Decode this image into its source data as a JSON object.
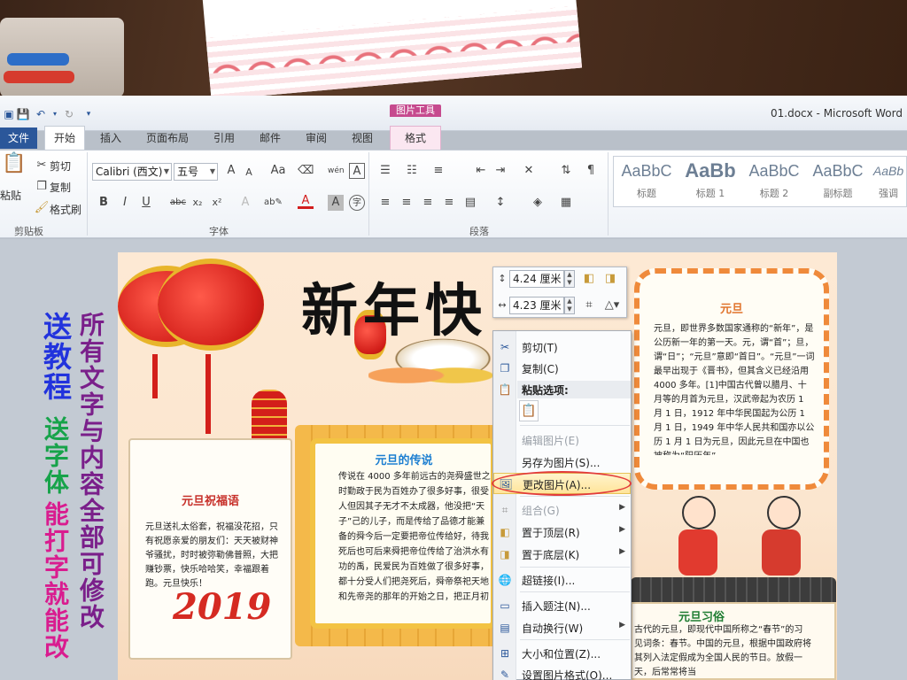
{
  "window": {
    "title": "01.docx - Microsoft Word",
    "picture_tools_label": "图片工具"
  },
  "tabs": {
    "file": "文件",
    "home": "开始",
    "insert": "插入",
    "page_layout": "页面布局",
    "references": "引用",
    "mailings": "邮件",
    "review": "审阅",
    "view": "视图",
    "format": "格式"
  },
  "clipboard": {
    "paste": "粘贴",
    "cut": "剪切",
    "copy": "复制",
    "format_painter": "格式刷",
    "group_label": "剪贴板"
  },
  "font": {
    "name": "Calibri (西文)",
    "size": "五号",
    "group_label": "字体",
    "bold": "B",
    "italic": "I",
    "underline": "U",
    "strike": "abc",
    "sub": "x₂",
    "sup": "x²",
    "grow": "A",
    "shrink": "A",
    "case": "Aa",
    "phonetic": "wén",
    "border": "A",
    "font_color": "A",
    "shade": "A",
    "enclose": "字"
  },
  "paragraph": {
    "group_label": "段落"
  },
  "styles": {
    "items": [
      {
        "preview": "AaBbC",
        "name": "标题"
      },
      {
        "preview": "AaBb",
        "name": "标题 1"
      },
      {
        "preview": "AaBbC",
        "name": "标题 2"
      },
      {
        "preview": "AaBbC",
        "name": "副标题"
      },
      {
        "preview": "AaBb",
        "name": "强调"
      }
    ]
  },
  "size_toolbar": {
    "height": "4.24 厘米",
    "width": "4.23 厘米"
  },
  "context_menu": {
    "cut": "剪切(T)",
    "copy": "复制(C)",
    "paste_options": "粘贴选项:",
    "edit_picture": "编辑图片(E)",
    "save_as_picture": "另存为图片(S)...",
    "change_picture": "更改图片(A)...",
    "group": "组合(G)",
    "bring_to_front": "置于顶层(R)",
    "send_to_back": "置于底层(K)",
    "hyperlink": "超链接(I)...",
    "insert_caption": "插入题注(N)...",
    "wrap_text": "自动换行(W)",
    "size_position": "大小和位置(Z)...",
    "format_picture": "设置图片格式(O)..."
  },
  "promo": {
    "line1": "送教程",
    "line2": "送字体",
    "line3": "能打字就能改",
    "line4": "所有文字与内容全部可修改"
  },
  "document": {
    "big_title": "新年快",
    "blessing": {
      "title": "元旦祝福语",
      "body": "元旦送礼太俗套，祝福没花招，只有祝愿亲爱的朋友们：天天被财神爷骚扰，时时被弥勒佛普照，大把赚钞票，快乐哈哈笑，幸福跟着跑。元旦快乐！"
    },
    "legend": {
      "title": "元旦的传说",
      "body": "传说在 4000 多年前远古的尧舜盛世之时勤政于民为百姓办了很多好事，很受人但因其子无才不太成器，他没把“天子”己的儿子，而是传给了品德才能兼备的舜今后一定要把帝位传给好，待我死后也可后来舜把帝位传给了治洪水有功的禹，民爱民为百姓做了很多好事，都十分受人们把尧死后，舜帝祭祀天地和先帝尧的那年的开始之日，把正月初一称为“元旦”这就是古代的元旦。"
    },
    "yuandan": {
      "title": "元旦",
      "body": "元旦，即世界多数国家通称的“新年”，是公历新一年的第一天。元，谓“首”；旦，谓“日”；“元旦”意即“首日”。“元旦”一词最早出现于《晋书》，但其含义已经沿用 4000 多年。[1]中国古代曾以腊月、十月等的月首为元旦，汉武帝起为农历 1 月 1 日，1912 年中华民国起为公历 1 月 1 日，1949 年中华人民共和国亦以公历 1 月 1 日为元旦，因此元旦在中国也被称为“阳历年”。"
    },
    "customs": {
      "title": "元旦习俗",
      "body": "古代的元旦，即现代中国所称之“春节”的习见词条：春节。中国的元旦，根据中国政府将其列入法定假成为全国人民的节日。放假一天，后常常将当"
    },
    "year": "2019"
  },
  "colors": {
    "accent": "#2b579a",
    "picture_tools": "#c64a8e",
    "highlight": "#ffe49a",
    "promo_blue": "#2233dd",
    "promo_green": "#17a34a",
    "promo_pink": "#d91c8f",
    "promo_purple": "#7a1f8a"
  }
}
